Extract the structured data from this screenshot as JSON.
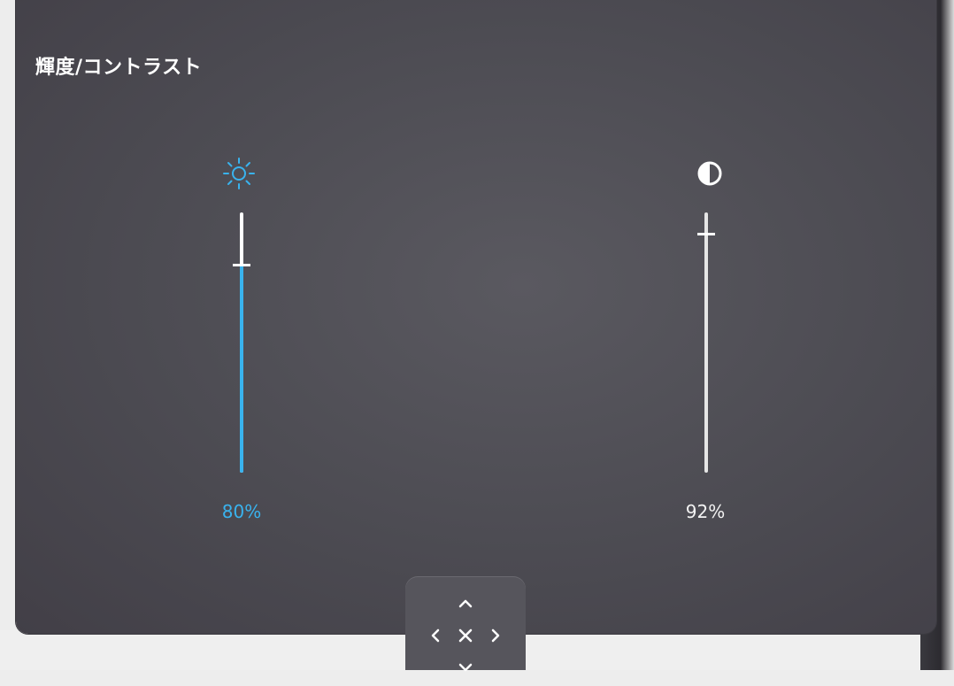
{
  "panel": {
    "title": "輝度/コントラスト"
  },
  "brightness": {
    "icon": "sun-icon",
    "value": 80,
    "label": "80%",
    "color": "#39b3ee"
  },
  "contrast": {
    "icon": "contrast-icon",
    "value": 92,
    "label": "92%",
    "color": "#e6e6e6"
  },
  "nav": {
    "up_icon": "chevron-up-icon",
    "left_icon": "chevron-left-icon",
    "close_icon": "close-icon",
    "right_icon": "chevron-right-icon",
    "down_icon": "chevron-down-icon"
  }
}
